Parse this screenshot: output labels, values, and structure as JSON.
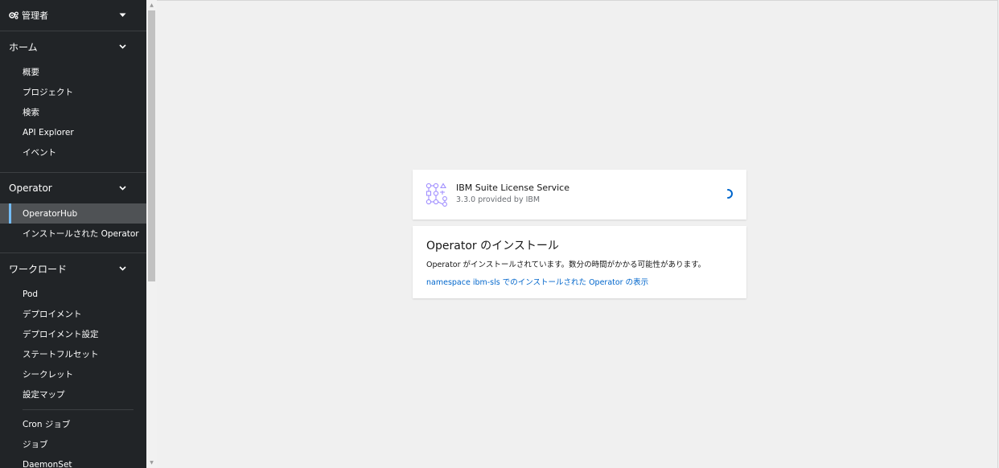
{
  "sidebar": {
    "perspective": {
      "label": "管理者",
      "icon": "cogs-icon"
    },
    "sections": {
      "home": {
        "title": "ホーム",
        "items": [
          "概要",
          "プロジェクト",
          "検索",
          "API Explorer",
          "イベント"
        ]
      },
      "operator": {
        "title": "Operator",
        "items": [
          "OperatorHub",
          "インストールされた Operator"
        ],
        "active": "OperatorHub"
      },
      "workloads": {
        "title": "ワークロード",
        "items": [
          "Pod",
          "デプロイメント",
          "デプロイメント設定",
          "ステートフルセット",
          "シークレット",
          "設定マップ"
        ],
        "items2": [
          "Cron ジョブ",
          "ジョブ",
          "DaemonSet"
        ]
      }
    }
  },
  "operator_card": {
    "name": "IBM Suite License Service",
    "subtitle": "3.3.0 provided by IBM"
  },
  "install_card": {
    "title": "Operator のインストール",
    "message": "Operator がインストールされています。数分の時間がかかる可能性があります。",
    "link": "namespace ibm-sls でのインストールされた Operator の表示"
  },
  "colors": {
    "sidebar_bg": "#212427",
    "active_bg": "#4f5255",
    "active_marker": "#73bcf7",
    "link": "#0066cc",
    "spinner": "#0066cc",
    "logo": "#a18fff"
  }
}
